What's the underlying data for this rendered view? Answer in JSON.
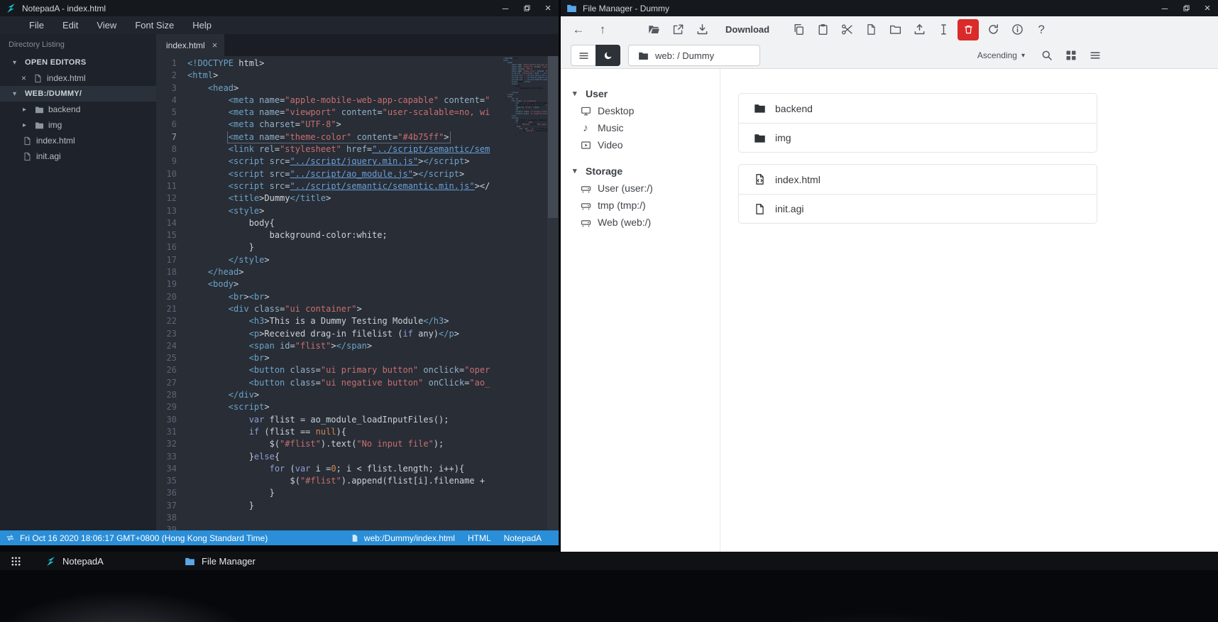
{
  "icons": {
    "close": "×",
    "minimize": "─",
    "back": "←",
    "up": "↑",
    "caret_down": "▾",
    "caret_right": "▸",
    "music": "♪",
    "help": "?"
  },
  "notepad": {
    "title": "NotepadA - index.html",
    "menu": [
      "File",
      "Edit",
      "View",
      "Font Size",
      "Help"
    ],
    "sidebar": {
      "header": "Directory Listing",
      "open_editors_label": "OPEN EDITORS",
      "open_editors": [
        {
          "name": "index.html"
        }
      ],
      "workspace_label": "WEB:/DUMMY/",
      "tree": [
        {
          "name": "backend"
        },
        {
          "name": "img"
        },
        {
          "name": "index.html"
        },
        {
          "name": "init.agi"
        }
      ]
    },
    "tab": {
      "name": "index.html"
    },
    "editor": {
      "selected_line": 7,
      "lines": [
        "<!DOCTYPE html>",
        "<html>",
        "    <head>",
        "        <meta name=\"apple-mobile-web-app-capable\" content=\"",
        "        <meta name=\"viewport\" content=\"user-scalable=no, wi",
        "        <meta charset=\"UTF-8\">",
        "        <meta name=\"theme-color\" content=\"#4b75ff\">",
        "        <link rel=\"stylesheet\" href=\"../script/semantic/sem",
        "        <script src=\"../script/jquery.min.js\"></script>",
        "        <script src=\"../script/ao_module.js\"></script>",
        "        <script src=\"../script/semantic/semantic.min.js\"></",
        "        <title>Dummy</title>",
        "        <style>",
        "            body{",
        "                background-color:white;",
        "            }",
        "        </style>",
        "    </head>",
        "    <body>",
        "        <br><br>",
        "        <div class=\"ui container\">",
        "            <h3>This is a Dummy Testing Module</h3>",
        "            <p>Received drag-in filelist (if any)</p>",
        "            <span id=\"flist\"></span>",
        "            <br>",
        "            <button class=\"ui primary button\" onclick=\"oper",
        "            <button class=\"ui negative button\" onClick=\"ao_",
        "        </div>",
        "        <script>",
        "            var flist = ao_module_loadInputFiles();",
        "            if (flist == null){",
        "                $(\"#flist\").text(\"No input file\");",
        "            }else{",
        "                for (var i =0; i < flist.length; i++){",
        "                    $(\"#flist\").append(flist[i].filename + ",
        "                }",
        "            }",
        "",
        ""
      ]
    },
    "statusbar": {
      "datetime": "Fri Oct 16 2020 18:06:17 GMT+0800 (Hong Kong Standard Time)",
      "file_path": "web:/Dummy/index.html",
      "language": "HTML",
      "app": "NotepadA"
    }
  },
  "filemanager": {
    "title": "File Manager - Dummy",
    "toolbar": {
      "download_label": "Download",
      "breadcrumb": "web: / Dummy",
      "sort": "Ascending"
    },
    "sidebar": {
      "sections": [
        {
          "label": "User",
          "items": [
            "Desktop",
            "Music",
            "Video"
          ]
        },
        {
          "label": "Storage",
          "items": [
            "User (user:/)",
            "tmp (tmp:/)",
            "Web (web:/)"
          ]
        }
      ]
    },
    "list": {
      "folders": [
        "backend",
        "img"
      ],
      "files": [
        "index.html",
        "init.agi"
      ]
    }
  },
  "taskbar": {
    "items": [
      "NotepadA",
      "File Manager"
    ]
  }
}
